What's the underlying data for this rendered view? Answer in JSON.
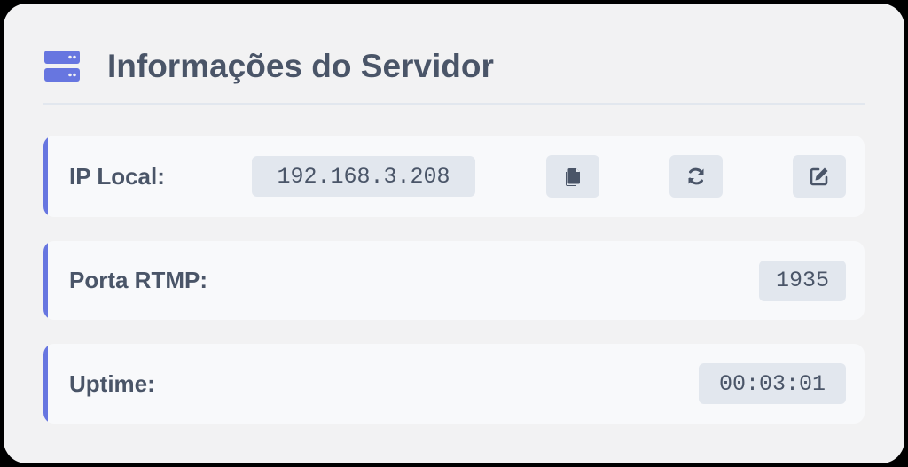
{
  "header": {
    "icon": "server-icon",
    "title": "Informações do Servidor"
  },
  "rows": [
    {
      "label": "IP Local:",
      "value": "192.168.3.208",
      "actions": [
        "copy-icon",
        "refresh-icon",
        "edit-icon"
      ]
    },
    {
      "label": "Porta RTMP:",
      "value": "1935"
    },
    {
      "label": "Uptime:",
      "value": "00:03:01"
    }
  ],
  "colors": {
    "accent": "#6776e0",
    "text": "#4a5568",
    "value_bg": "#e2e7ee",
    "card_bg": "#f2f2f3",
    "row_bg": "#f8f9fb"
  }
}
